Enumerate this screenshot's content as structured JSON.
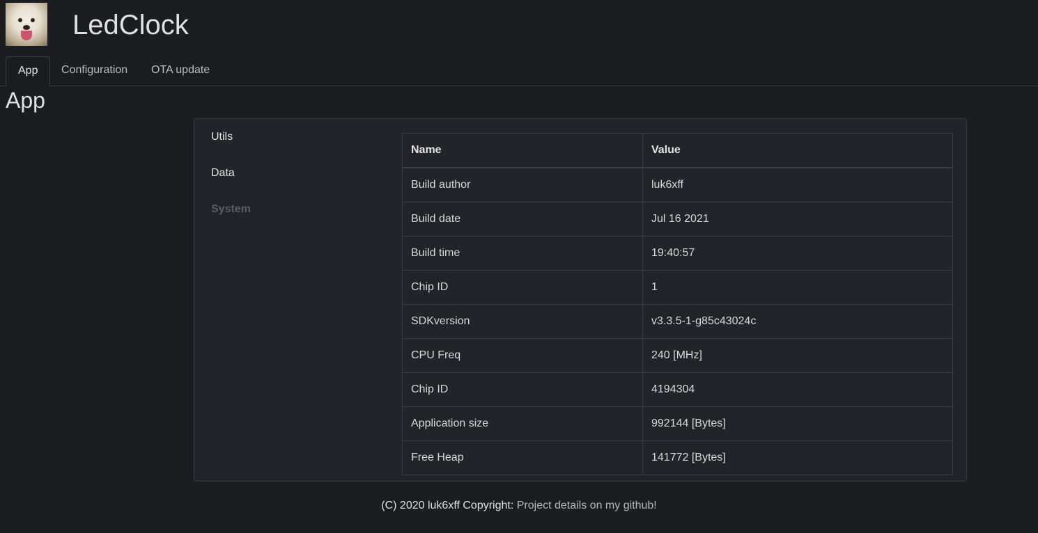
{
  "header": {
    "title": "LedClock"
  },
  "tabs": [
    {
      "label": "App"
    },
    {
      "label": "Configuration"
    },
    {
      "label": "OTA update"
    }
  ],
  "page": {
    "heading": "App"
  },
  "sidenav": [
    {
      "label": "Utils"
    },
    {
      "label": "Data"
    },
    {
      "label": "System"
    }
  ],
  "table": {
    "headers": [
      "Name",
      "Value"
    ],
    "rows": [
      [
        "Build author",
        "luk6xff"
      ],
      [
        "Build date",
        "Jul 16 2021"
      ],
      [
        "Build time",
        "19:40:57"
      ],
      [
        "Chip ID",
        "1"
      ],
      [
        "SDKversion",
        "v3.3.5-1-g85c43024c"
      ],
      [
        "CPU Freq",
        "240 [MHz]"
      ],
      [
        "Chip ID",
        "4194304"
      ],
      [
        "Application size",
        "992144 [Bytes]"
      ],
      [
        "Free Heap",
        "141772 [Bytes]"
      ]
    ]
  },
  "footer": {
    "text": "(C) 2020 luk6xff Copyright: ",
    "link": "Project details on my github!"
  },
  "colors": {
    "background": "#1b1d21",
    "card": "#212429",
    "border": "#3a3d42"
  }
}
